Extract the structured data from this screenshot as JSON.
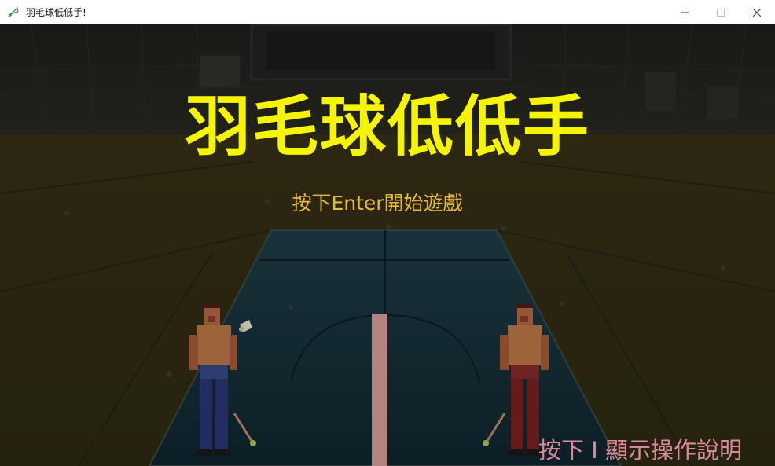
{
  "window": {
    "title": "羽毛球低低手!",
    "app_icon": "badminton-app-icon",
    "buttons": {
      "minimize_icon": "minimize-icon",
      "maximize_icon": "maximize-icon",
      "close_icon": "close-icon"
    }
  },
  "game": {
    "title": "羽毛球低低手",
    "start_prompt": "按下Enter開始遊戲",
    "help_prompt": "按下 I 顯示操作說明",
    "colors": {
      "title": "#f5f500",
      "start_prompt": "#e8b83a",
      "help_prompt": "#d98a9c",
      "court": "#16303a",
      "net": "#d9a3a0"
    },
    "players": [
      {
        "side": "left",
        "shorts": "blue"
      },
      {
        "side": "right",
        "shorts": "red"
      }
    ]
  }
}
